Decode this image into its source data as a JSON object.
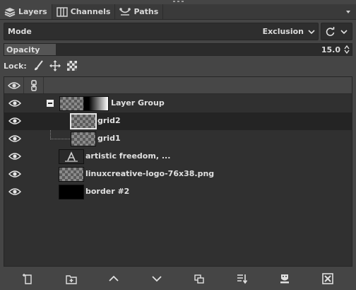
{
  "tabs": [
    {
      "label": "Layers",
      "icon": "layers-icon"
    },
    {
      "label": "Channels",
      "icon": "channels-icon"
    },
    {
      "label": "Paths",
      "icon": "paths-icon"
    }
  ],
  "mode": {
    "label": "Mode",
    "value": "Exclusion"
  },
  "opacity": {
    "label": "Opacity",
    "value": "15.0",
    "fraction": 0.15
  },
  "lock": {
    "label": "Lock:",
    "icons": [
      "paintbrush-icon",
      "move-icon",
      "alpha-checker-icon"
    ]
  },
  "layers": [
    {
      "name": "Layer Group",
      "kind": "group",
      "visible": true
    },
    {
      "name": "grid2",
      "kind": "child",
      "visible": true,
      "selected": true
    },
    {
      "name": "grid1",
      "kind": "child",
      "visible": true
    },
    {
      "name": "artistic freedom, ...",
      "kind": "text",
      "visible": true
    },
    {
      "name": "linuxcreative-logo-76x38.png",
      "kind": "image",
      "visible": true
    },
    {
      "name": "border #2",
      "kind": "black",
      "visible": true
    }
  ],
  "bottom_buttons": [
    "new-layer-icon",
    "new-group-icon",
    "raise-layer-icon",
    "lower-layer-icon",
    "duplicate-layer-icon",
    "merge-down-icon",
    "add-mask-icon",
    "delete-layer-icon"
  ]
}
